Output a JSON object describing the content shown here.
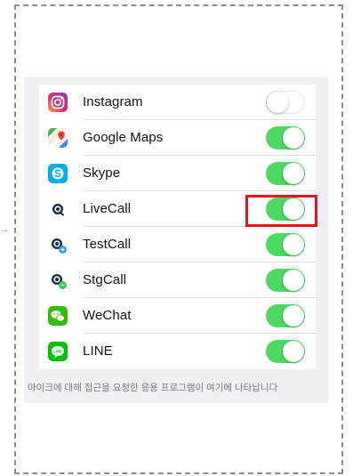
{
  "settings": {
    "apps": [
      {
        "name": "Instagram",
        "enabled": false,
        "icon": "instagram-icon"
      },
      {
        "name": "Google Maps",
        "enabled": true,
        "icon": "google-maps-icon"
      },
      {
        "name": "Skype",
        "enabled": true,
        "icon": "skype-icon"
      },
      {
        "name": "LiveCall",
        "enabled": true,
        "icon": "livecall-icon"
      },
      {
        "name": "TestCall",
        "enabled": true,
        "icon": "testcall-icon"
      },
      {
        "name": "StgCall",
        "enabled": true,
        "icon": "stgcall-icon"
      },
      {
        "name": "WeChat",
        "enabled": true,
        "icon": "wechat-icon"
      },
      {
        "name": "LINE",
        "enabled": true,
        "icon": "line-icon"
      }
    ],
    "footer_note": "마이크에 대해 접근을 요청한 응용 프로그램이 여기에 나타납니다",
    "highlighted_app": "LiveCall"
  },
  "colors": {
    "toggle_on": "#4cd964",
    "highlight": "#e8141b",
    "background": "#efeff4"
  }
}
